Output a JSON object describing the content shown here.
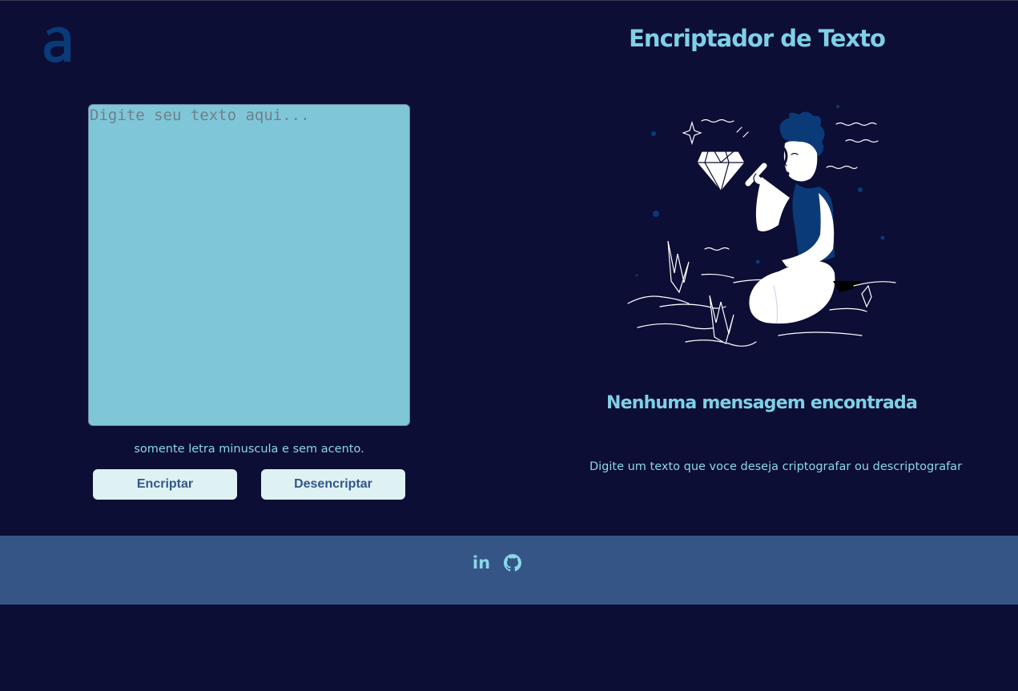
{
  "header": {
    "title": "Encriptador de Texto"
  },
  "input": {
    "placeholder": "Digite seu texto aqui...",
    "value": ""
  },
  "hint": "somente letra minuscula e sem acento.",
  "buttons": {
    "encrypt": "Encriptar",
    "decrypt": "Desencriptar"
  },
  "output": {
    "empty_title": "Nenhuma mensagem encontrada",
    "empty_description": "Digite um texto que voce deseja criptografar ou descriptografar"
  },
  "footer": {
    "linkedin_label": "in",
    "icons": [
      "linkedin-icon",
      "github-icon"
    ]
  },
  "colors": {
    "background": "#0d0e35",
    "accent": "#7fd0e6",
    "textarea": "#80c6d9",
    "button": "#def2f4",
    "button_text": "#35558a",
    "footer": "#355586",
    "logo": "#0a3a78"
  }
}
